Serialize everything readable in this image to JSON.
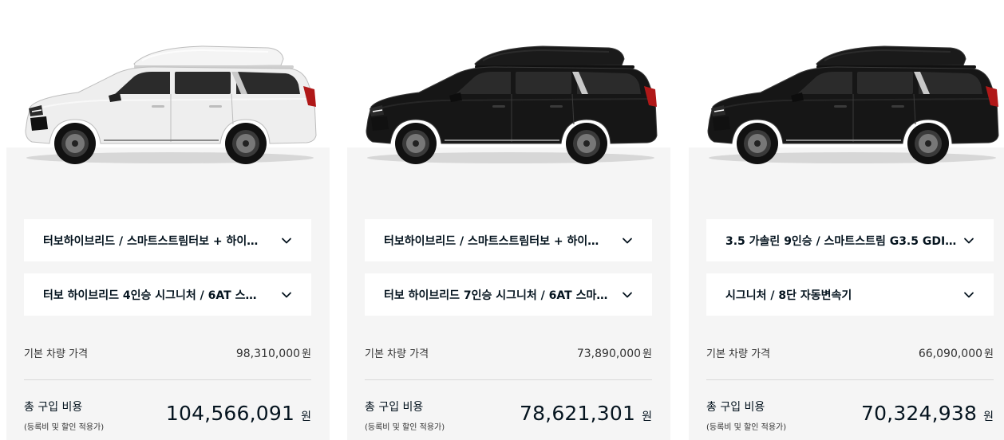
{
  "cards": [
    {
      "car_color": "white",
      "trim_select": "터보하이브리드 / 스마트스트림터보 + 하이…",
      "option_select": "터보 하이브리드 4인승 시그니처 / 6AT 스…",
      "base_label": "기본 차량 가격",
      "base_price": "98,310,000",
      "base_unit": "원",
      "total_label": "총 구입 비용",
      "total_note": "(등록비 및 할인 적용가)",
      "total_price": "104,566,091",
      "total_unit": "원"
    },
    {
      "car_color": "black",
      "trim_select": "터보하이브리드 / 스마트스트림터보 + 하이…",
      "option_select": "터보 하이브리드 7인승 시그니처 / 6AT 스마…",
      "base_label": "기본 차량 가격",
      "base_price": "73,890,000",
      "base_unit": "원",
      "total_label": "총 구입 비용",
      "total_note": "(등록비 및 할인 적용가)",
      "total_price": "78,621,301",
      "total_unit": "원"
    },
    {
      "car_color": "black",
      "trim_select": "3.5 가솔린 9인승 / 스마트스트림 G3.5 GDI…",
      "option_select": "시그니처 / 8단 자동변속기",
      "base_label": "기본 차량 가격",
      "base_price": "66,090,000",
      "base_unit": "원",
      "total_label": "총 구입 비용",
      "total_note": "(등록비 및 할인 적용가)",
      "total_price": "70,324,938",
      "total_unit": "원"
    }
  ],
  "icons": {
    "dropdown": "chevron-down-icon"
  }
}
